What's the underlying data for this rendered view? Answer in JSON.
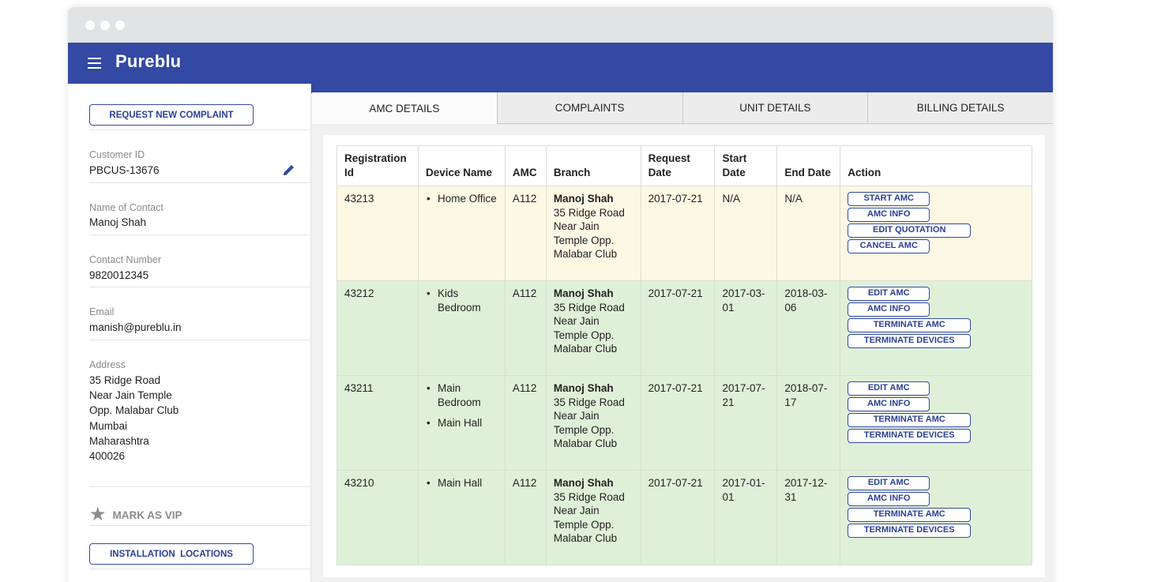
{
  "app": {
    "title": "Pureblu"
  },
  "sidebar": {
    "request_button": "REQUEST NEW COMPLAINT",
    "fields": [
      {
        "label": "Customer ID",
        "value": "PBCUS-13676"
      },
      {
        "label": "Name of Contact",
        "value": "Manoj Shah"
      },
      {
        "label": "Contact Number",
        "value": "9820012345"
      },
      {
        "label": "Email",
        "value": "manish@pureblu.in"
      },
      {
        "label": "Address",
        "lines": [
          "35 Ridge Road",
          "Near Jain Temple",
          "Opp. Malabar Club",
          "Mumbai",
          "Maharashtra",
          "400026"
        ]
      }
    ],
    "vip_label": "MARK AS VIP",
    "install_button": "INSTALLATION  LOCATIONS"
  },
  "tabs": [
    "AMC DETAILS",
    "COMPLAINTS",
    "UNIT DETAILS",
    "BILLING DETAILS"
  ],
  "active_tab": 0,
  "table": {
    "headers": [
      "Registration Id",
      "Device Name",
      "AMC",
      "Branch",
      "Request Date",
      "Start Date",
      "End Date",
      "Action"
    ],
    "rows": [
      {
        "status": "pending",
        "reg_id": "43213",
        "devices": [
          "Home Office"
        ],
        "amc": "A112",
        "branch_name": "Manoj Shah",
        "branch_address": "35 Ridge Road Near Jain Temple Opp. Malabar Club",
        "request_date": "2017-07-21",
        "start_date": "N/A",
        "end_date": "N/A",
        "actions": [
          "START AMC",
          "AMC INFO",
          "EDIT QUOTATION",
          "CANCEL AMC"
        ]
      },
      {
        "status": "active",
        "reg_id": "43212",
        "devices": [
          "Kids Bedroom"
        ],
        "amc": "A112",
        "branch_name": "Manoj Shah",
        "branch_address": "35 Ridge Road Near Jain Temple Opp. Malabar Club",
        "request_date": "2017-07-21",
        "start_date": "2017-03-01",
        "end_date": "2018-03-06",
        "actions": [
          "EDIT AMC",
          "AMC INFO",
          "TERMINATE AMC",
          "TERMINATE DEVICES"
        ]
      },
      {
        "status": "active",
        "reg_id": "43211",
        "devices": [
          "Main Bedroom",
          "Main Hall"
        ],
        "amc": "A112",
        "branch_name": "Manoj Shah",
        "branch_address": "35 Ridge Road Near Jain Temple Opp. Malabar Club",
        "request_date": "2017-07-21",
        "start_date": "2017-07-21",
        "end_date": "2018-07-17",
        "actions": [
          "EDIT AMC",
          "AMC INFO",
          "TERMINATE AMC",
          "TERMINATE DEVICES"
        ]
      },
      {
        "status": "active",
        "reg_id": "43210",
        "devices": [
          "Main Hall"
        ],
        "amc": "A112",
        "branch_name": "Manoj Shah",
        "branch_address": "35 Ridge Road Near Jain Temple Opp. Malabar Club",
        "request_date": "2017-07-21",
        "start_date": "2017-01-01",
        "end_date": "2017-12-31",
        "actions": [
          "EDIT AMC",
          "AMC INFO",
          "TERMINATE AMC",
          "TERMINATE DEVICES"
        ]
      }
    ]
  },
  "colors": {
    "brand": "#3349a3",
    "pending_row": "#fcf8e4",
    "active_row": "#dff0d8"
  },
  "icons": {
    "menu": "hamburger-icon",
    "edit": "pencil-icon",
    "vip": "star-icon"
  }
}
